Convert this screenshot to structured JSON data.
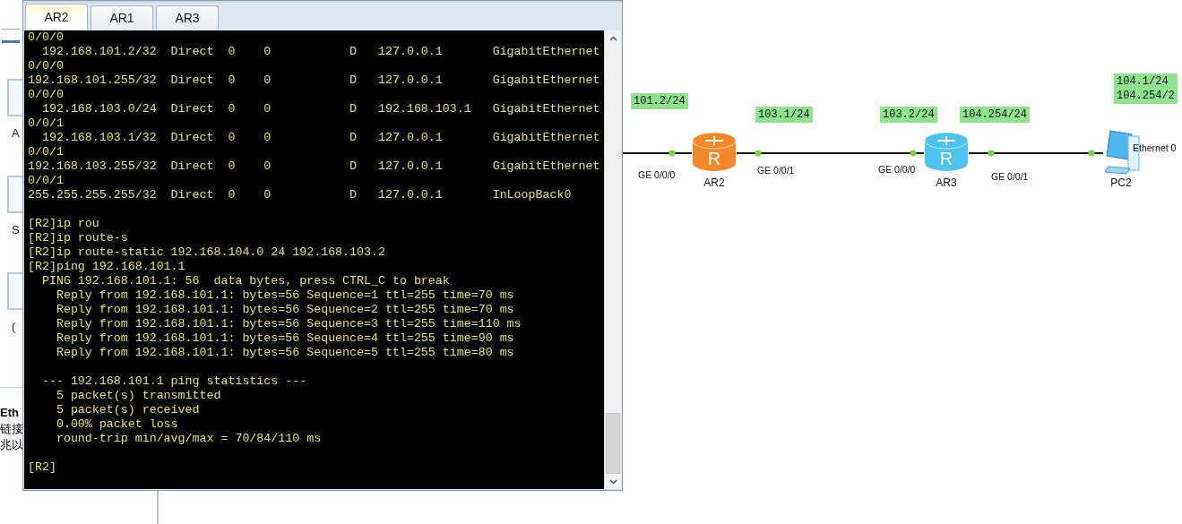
{
  "side_panel": {
    "items": [
      {
        "label": "A"
      },
      {
        "label": "S"
      },
      {
        "label": "("
      }
    ],
    "details": {
      "title": "Eth",
      "lines": [
        "链接",
        "兆以"
      ]
    }
  },
  "terminal_window": {
    "tabs": [
      {
        "label": "AR2",
        "selected": true
      },
      {
        "label": "AR1",
        "selected": false
      },
      {
        "label": "AR3",
        "selected": false
      }
    ],
    "blocks": [
      [
        "0/0/0",
        "  192.168.101.2/32  Direct  0    0           D   127.0.0.1       GigabitEthernet",
        "0/0/0",
        "192.168.101.255/32  Direct  0    0           D   127.0.0.1       GigabitEthernet",
        "0/0/0",
        "  192.168.103.0/24  Direct  0    0           D   192.168.103.1   GigabitEthernet",
        "0/0/1",
        "  192.168.103.1/32  Direct  0    0           D   127.0.0.1       GigabitEthernet",
        "0/0/1",
        "192.168.103.255/32  Direct  0    0           D   127.0.0.1       GigabitEthernet",
        "0/0/1",
        "255.255.255.255/32  Direct  0    0           D   127.0.0.1       InLoopBack0"
      ],
      [
        "[R2]ip rou",
        "[R2]ip route-s",
        "[R2]ip route-static 192.168.104.0 24 192.168.103.2",
        "[R2]ping 192.168.101.1",
        "  PING 192.168.101.1: 56  data bytes, press CTRL_C to break",
        "    Reply from 192.168.101.1: bytes=56 Sequence=1 ttl=255 time=70 ms",
        "    Reply from 192.168.101.1: bytes=56 Sequence=2 ttl=255 time=70 ms",
        "    Reply from 192.168.101.1: bytes=56 Sequence=3 ttl=255 time=110 ms",
        "    Reply from 192.168.101.1: bytes=56 Sequence=4 ttl=255 time=90 ms",
        "    Reply from 192.168.101.1: bytes=56 Sequence=5 ttl=255 time=80 ms"
      ],
      [
        "  --- 192.168.101.1 ping statistics ---",
        "    5 packet(s) transmitted",
        "    5 packet(s) received",
        "    0.00% packet loss",
        "    round-trip min/avg/max = 70/84/110 ms"
      ],
      [
        "[R2]"
      ]
    ]
  },
  "topology": {
    "nodes": [
      {
        "kind": "router",
        "name": "AR2",
        "badge": "R",
        "color": "#f5892a"
      },
      {
        "kind": "router",
        "name": "AR3",
        "badge": "R",
        "color": "#4fc3f0"
      },
      {
        "kind": "pc",
        "name": "PC2"
      }
    ],
    "ports": [
      {
        "label": "GE 0/0/0"
      },
      {
        "label": "GE 0/0/1"
      },
      {
        "label": "GE 0/0/0"
      },
      {
        "label": "GE 0/0/1"
      },
      {
        "label": "Ethernet 0"
      }
    ],
    "addresses": [
      {
        "lines": [
          "101.2/24"
        ]
      },
      {
        "lines": [
          "103.1/24"
        ]
      },
      {
        "lines": [
          "103.2/24"
        ]
      },
      {
        "lines": [
          "104.254/24"
        ]
      },
      {
        "lines": [
          "104.1/24",
          "104.254/2"
        ]
      }
    ]
  }
}
